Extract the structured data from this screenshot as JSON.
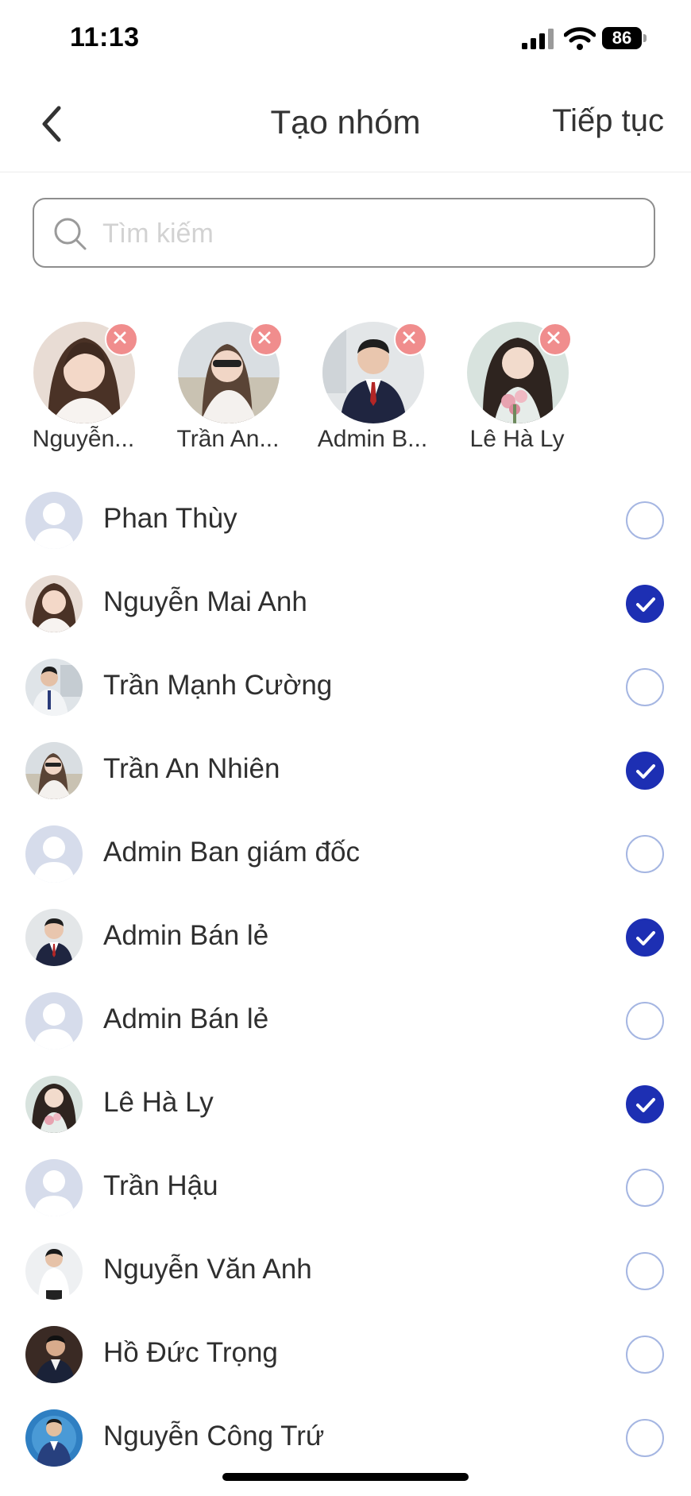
{
  "status_bar": {
    "time": "11:13",
    "battery": "86"
  },
  "header": {
    "title": "Tạo nhóm",
    "continue_label": "Tiếp tục"
  },
  "search": {
    "placeholder": "Tìm kiếm",
    "value": ""
  },
  "selected": [
    {
      "name": "Nguyễn...",
      "avatar": "photo-girl-1"
    },
    {
      "name": "Trần An...",
      "avatar": "photo-girl-2"
    },
    {
      "name": "Admin B...",
      "avatar": "photo-man-suit"
    },
    {
      "name": "Lê Hà Ly",
      "avatar": "photo-girl-flowers"
    }
  ],
  "contacts": [
    {
      "name": "Phan Thùy",
      "avatar": "default-avatar",
      "checked": false
    },
    {
      "name": "Nguyễn Mai Anh",
      "avatar": "photo-girl-1",
      "checked": true
    },
    {
      "name": "Trần Mạnh Cường",
      "avatar": "photo-man-office",
      "checked": false
    },
    {
      "name": "Trần An Nhiên",
      "avatar": "photo-girl-2",
      "checked": true
    },
    {
      "name": "Admin Ban giám đốc",
      "avatar": "default-avatar",
      "checked": false
    },
    {
      "name": "Admin Bán lẻ",
      "avatar": "photo-man-suit",
      "checked": true
    },
    {
      "name": "Admin Bán lẻ",
      "avatar": "default-avatar",
      "checked": false
    },
    {
      "name": "Lê Hà Ly",
      "avatar": "photo-girl-flowers",
      "checked": true
    },
    {
      "name": "Trần Hậu",
      "avatar": "default-avatar",
      "checked": false
    },
    {
      "name": "Nguyễn Văn Anh",
      "avatar": "photo-man-white-shirt",
      "checked": false
    },
    {
      "name": "Hồ Đức Trọng",
      "avatar": "photo-man-dark",
      "checked": false
    },
    {
      "name": "Nguyễn Công Trứ",
      "avatar": "photo-man-blue-suit",
      "checked": false
    }
  ],
  "colors": {
    "accent": "#1d2fb3",
    "unchecked_ring": "#a5b6e2",
    "remove_badge": "#f08d8d",
    "default_avatar_bg": "#d6dceb"
  }
}
